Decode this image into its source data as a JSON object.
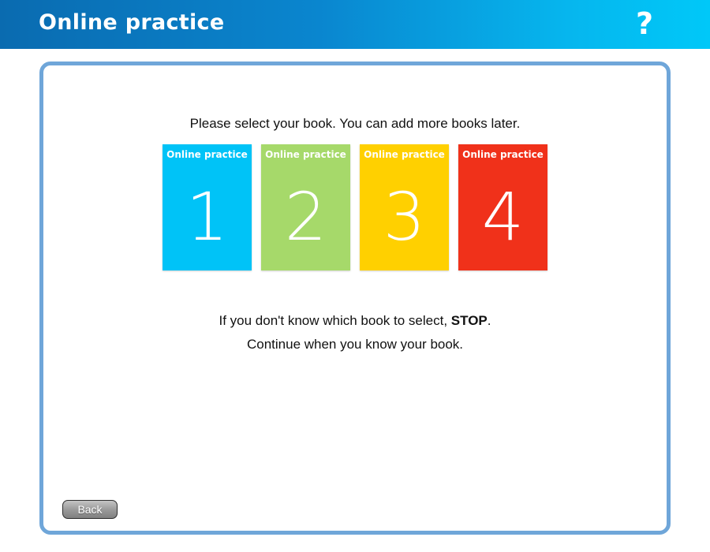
{
  "header": {
    "title": "Online practice",
    "help_glyph": "?",
    "help_icon": "question-mark-icon"
  },
  "main": {
    "instruction": "Please select your book. You can add more books later.",
    "books": [
      {
        "label": "Online practice",
        "number": "1",
        "color": "#00c3f7"
      },
      {
        "label": "Online practice",
        "number": "2",
        "color": "#a6d96a"
      },
      {
        "label": "Online practice",
        "number": "3",
        "color": "#ffd000"
      },
      {
        "label": "Online practice",
        "number": "4",
        "color": "#f0311a"
      }
    ],
    "note_line1_prefix": "If you don't know which book to select, ",
    "note_line1_bold": "STOP",
    "note_line1_suffix": ".",
    "note_line2": "Continue when you know your book."
  },
  "footer": {
    "back_label": "Back"
  },
  "colors": {
    "panel_border": "#6fa6d9",
    "header_gradient_start": "#0a6bb0",
    "header_gradient_end": "#00c8f8"
  }
}
